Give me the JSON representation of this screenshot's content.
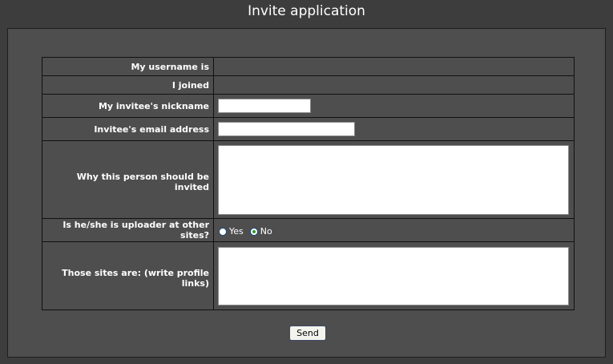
{
  "header": {
    "title": "Invite application"
  },
  "form": {
    "rows": [
      {
        "label": "My username is",
        "value": ""
      },
      {
        "label": "I joined",
        "value": ""
      },
      {
        "label": "My invitee's nickname",
        "value": ""
      },
      {
        "label": "Invitee's email address",
        "value": ""
      },
      {
        "label": "Why this person should be invited",
        "value": ""
      },
      {
        "label": "Is he/she is uploader at other sites?",
        "options": [
          "Yes",
          "No"
        ],
        "selected": "No"
      },
      {
        "label": "Those sites are: (write profile links)",
        "value": ""
      }
    ],
    "submit_label": "Send"
  }
}
